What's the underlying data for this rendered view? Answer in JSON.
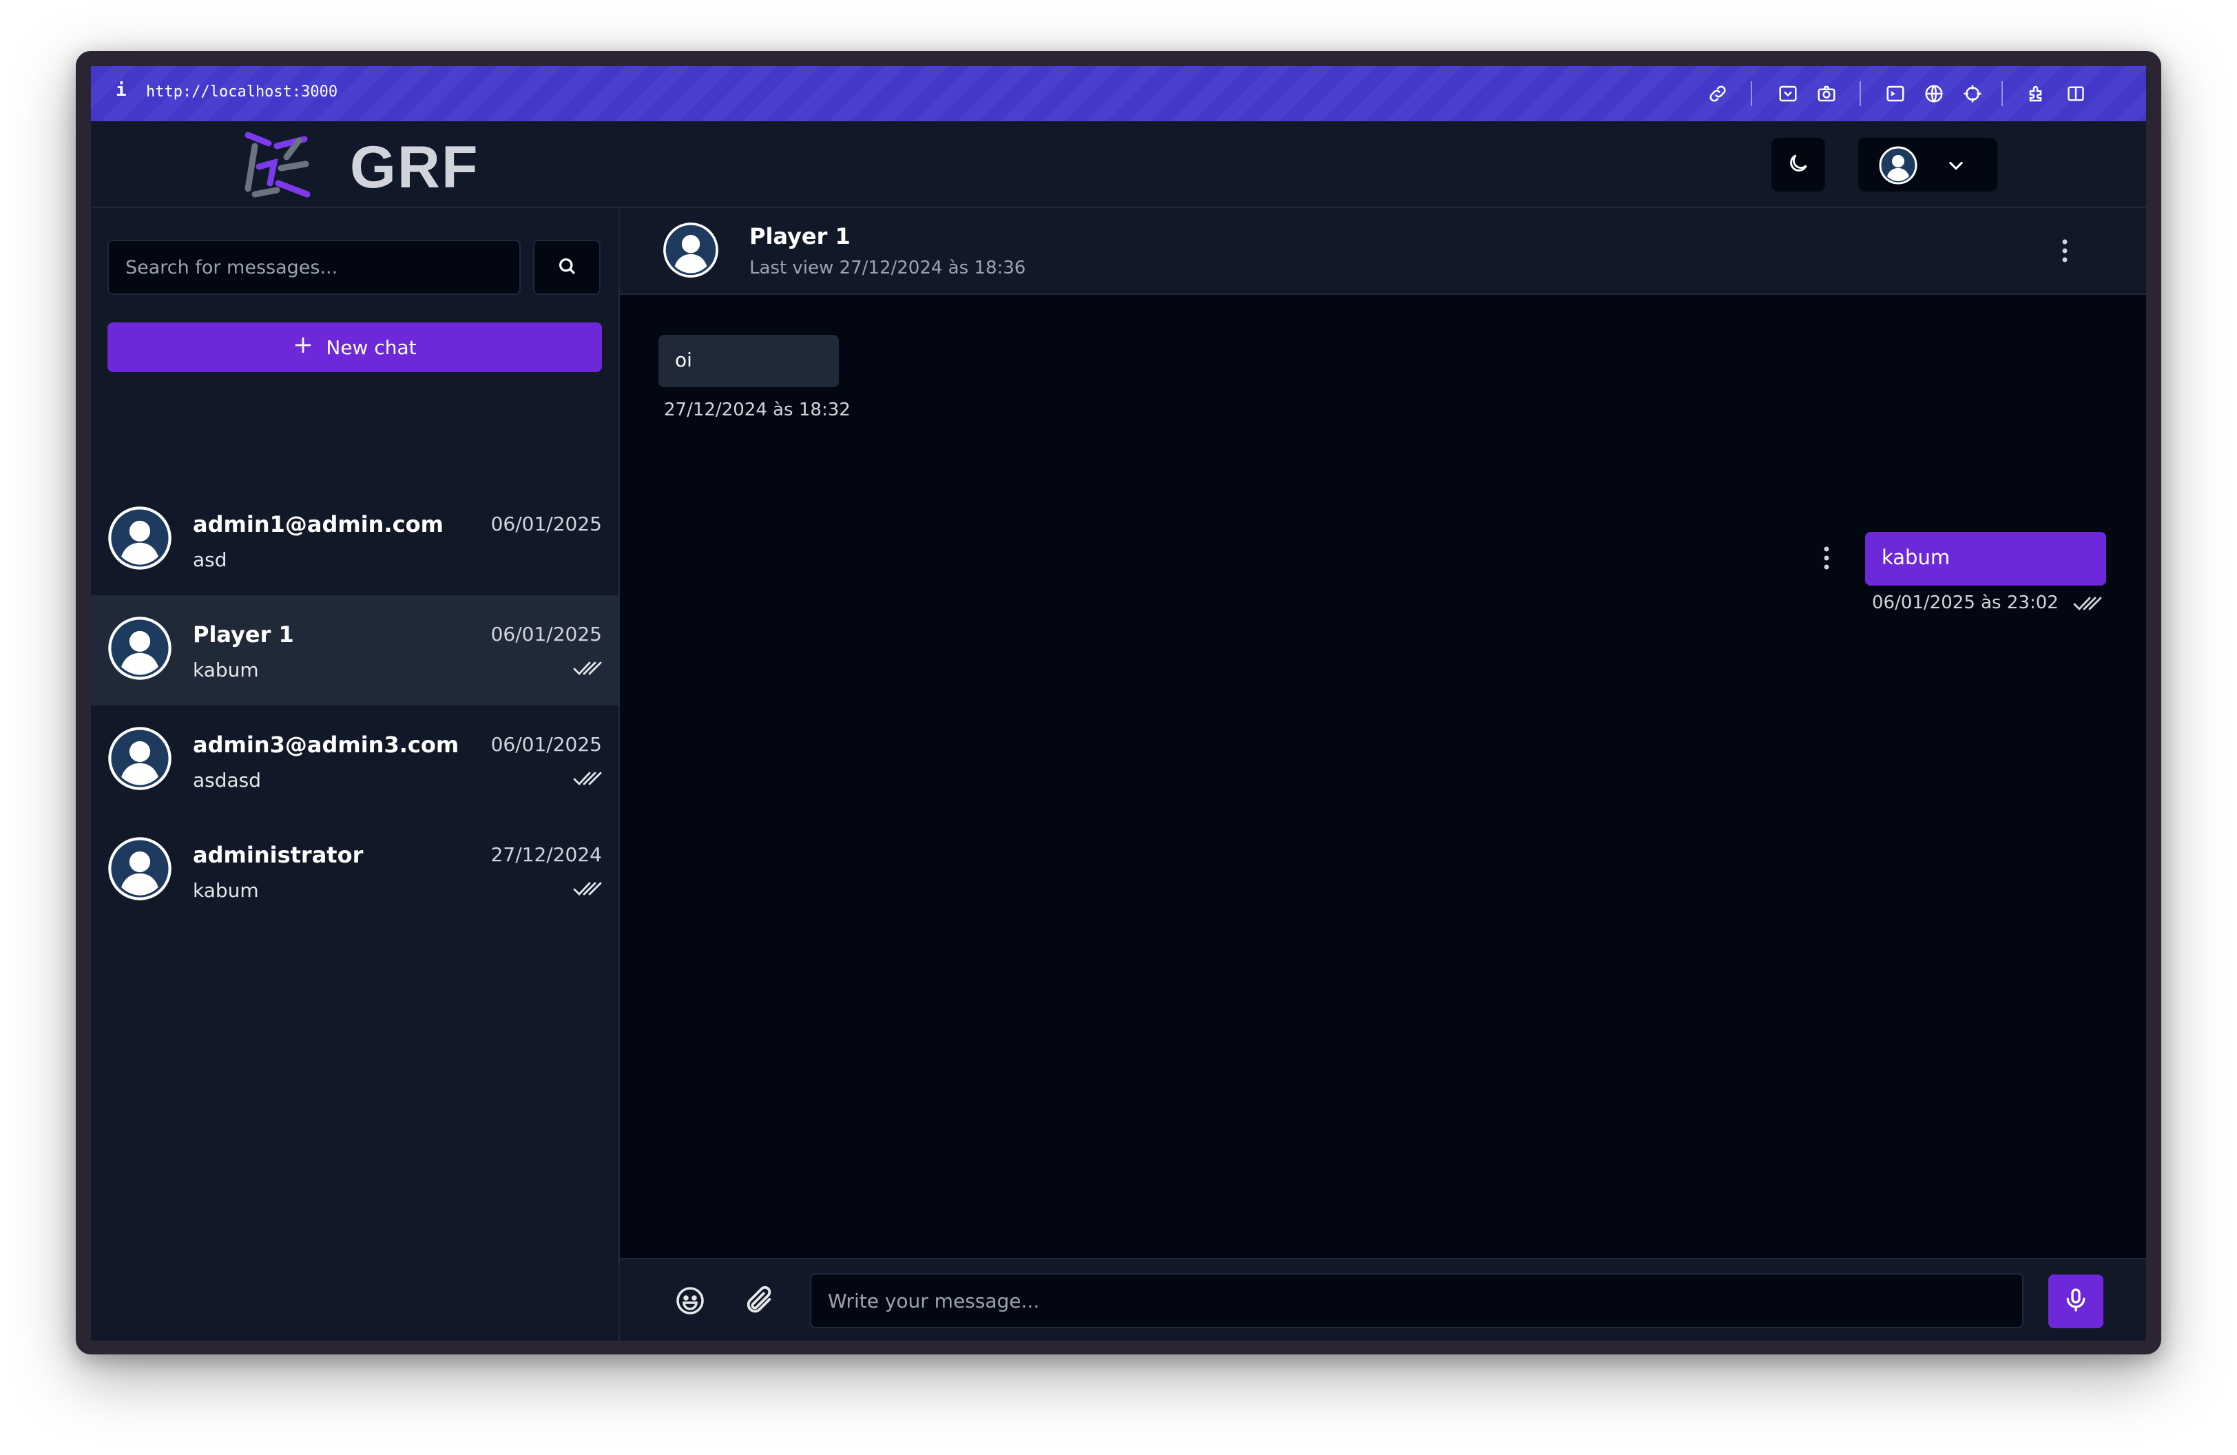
{
  "browser": {
    "info_label": "i",
    "url": "http://localhost:3000",
    "icons": [
      "link-icon",
      "download-icon",
      "camera-icon",
      "terminal-icon",
      "globe-icon",
      "crosshair-icon",
      "extensions-icon",
      "split-view-icon"
    ]
  },
  "header": {
    "brand": "GRF",
    "theme_icon": "moon-icon",
    "user_icon": "user-avatar-icon",
    "dropdown_icon": "chevron-down-icon"
  },
  "sidebar": {
    "search_placeholder": "Search for messages...",
    "new_chat_label": "New chat",
    "chats": [
      {
        "name": "admin1@admin.com",
        "date": "06/01/2025",
        "last_message": "asd",
        "read": false,
        "active": false
      },
      {
        "name": "Player 1",
        "date": "06/01/2025",
        "last_message": "kabum",
        "read": true,
        "active": true
      },
      {
        "name": "admin3@admin3.com",
        "date": "06/01/2025",
        "last_message": "asdasd",
        "read": true,
        "active": false
      },
      {
        "name": "administrator",
        "date": "27/12/2024",
        "last_message": "kabum",
        "read": true,
        "active": false
      }
    ]
  },
  "conversation": {
    "name": "Player 1",
    "last_view": "Last view 27/12/2024 às 18:36",
    "messages": [
      {
        "direction": "in",
        "text": "oi",
        "time": "27/12/2024 às 18:32"
      },
      {
        "direction": "out",
        "text": "kabum",
        "time": "06/01/2025 às 23:02",
        "read": true
      }
    ],
    "composer_placeholder": "Write your message..."
  },
  "colors": {
    "accent": "#6d28d9",
    "browser_bar": "#4338ca",
    "panel": "#111827",
    "messages_bg": "#030712"
  }
}
